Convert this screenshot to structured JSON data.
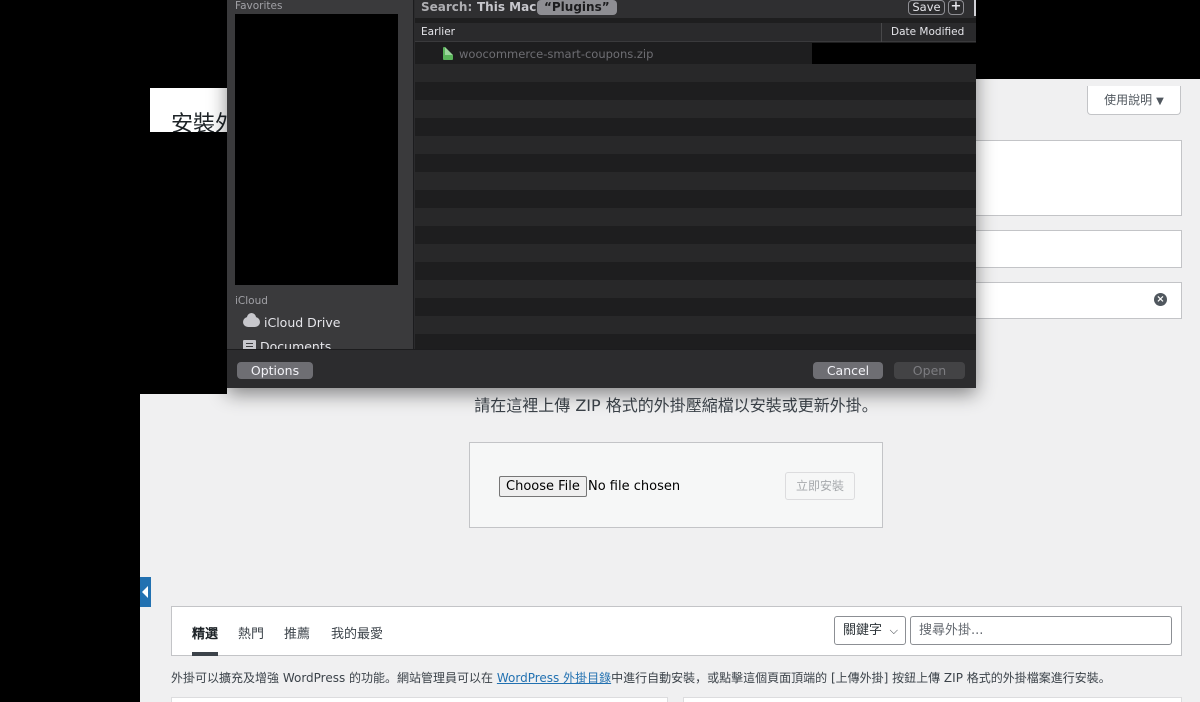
{
  "wp": {
    "page_title": "安裝外掛",
    "help_label": "使用說明",
    "help_arrow": "▼",
    "dismiss_symbol": "×",
    "upload_description": "請在這裡上傳 ZIP 格式的外掛壓縮檔以安裝或更新外掛。",
    "choose_file_label": "Choose File",
    "no_file_label": "No file chosen",
    "install_now_label": "立即安裝",
    "tabs": [
      {
        "label": "精選",
        "current": true
      },
      {
        "label": "熱門",
        "current": false
      },
      {
        "label": "推薦",
        "current": false
      },
      {
        "label": "我的最愛",
        "current": false
      }
    ],
    "search_type_label": "關鍵字",
    "search_type_chevron": "⌵",
    "search_placeholder": "搜尋外掛...",
    "intro_before": "外掛可以擴充及增強 WordPress 的功能。網站管理員可以在 ",
    "intro_link": "WordPress 外掛目錄",
    "intro_after": "中進行自動安裝，或點擊這個頁面頂端的 [上傳外掛] 按鈕上傳 ZIP 格式的外掛檔案進行安裝。",
    "accent_color": "#2271b1"
  },
  "dialog": {
    "sidebar": {
      "favorites_heading": "Favorites",
      "icloud_heading": "iCloud",
      "items": [
        {
          "label": "iCloud Drive",
          "icon": "cloud-icon"
        },
        {
          "label": "Documents",
          "icon": "document-icon"
        }
      ]
    },
    "scope": {
      "label": "Search:",
      "this_mac": "This Mac",
      "plugins": "“Plugins”",
      "save": "Save",
      "plus": "+"
    },
    "columns": {
      "group": "Earlier",
      "date": "Date Modified"
    },
    "files": [
      {
        "name": "woocommerce-smart-coupons.zip",
        "icon": "zip-file-icon"
      }
    ],
    "footer": {
      "options": "Options",
      "cancel": "Cancel",
      "open": "Open"
    }
  }
}
